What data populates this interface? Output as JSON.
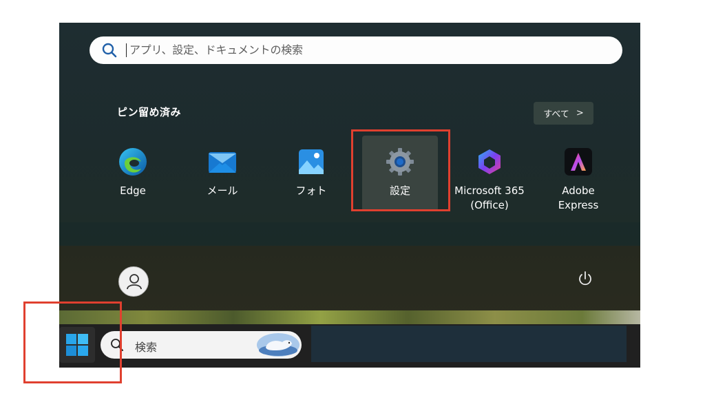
{
  "search": {
    "placeholder": "アプリ、設定、ドキュメントの検索"
  },
  "pinned": {
    "title": "ピン留め済み",
    "all_button_label": "すべて",
    "all_button_chevron": ">",
    "apps": [
      {
        "label": "Edge",
        "icon": "edge-icon"
      },
      {
        "label": "メール",
        "icon": "mail-icon"
      },
      {
        "label": "フォト",
        "icon": "photos-icon"
      },
      {
        "label": "設定",
        "icon": "settings-gear-icon"
      },
      {
        "label": "Microsoft 365\n(Office)",
        "label_line1": "Microsoft 365",
        "label_line2": "(Office)",
        "icon": "microsoft-365-icon"
      },
      {
        "label": "Adobe Express",
        "icon": "adobe-express-icon"
      }
    ]
  },
  "taskbar": {
    "search_placeholder": "検索"
  },
  "colors": {
    "highlight": "#e0402f",
    "menu_bg": "#1d2b2d",
    "taskbar_bg": "#202020"
  }
}
